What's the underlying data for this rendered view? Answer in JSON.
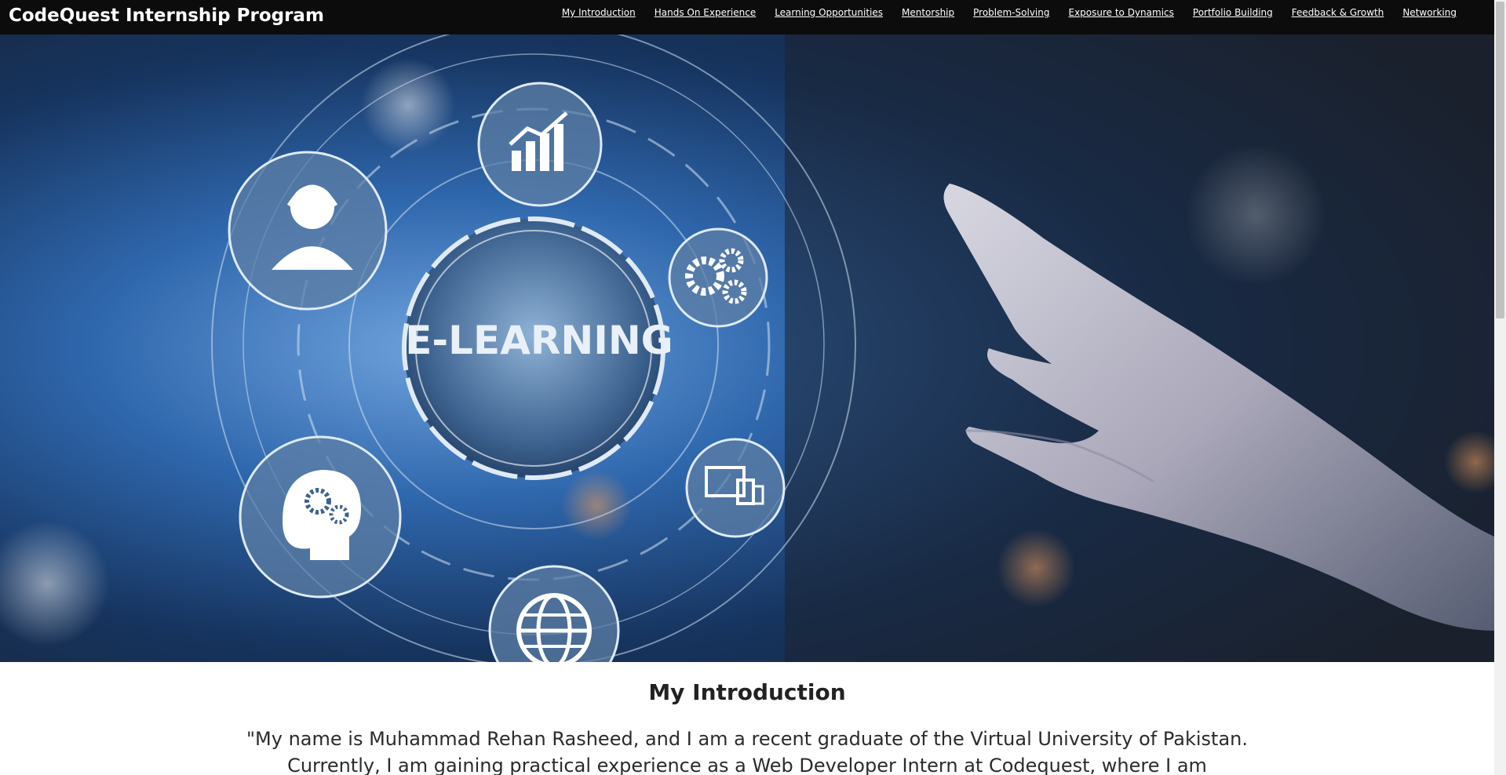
{
  "header": {
    "brand": "CodeQuest Internship Program",
    "nav": [
      "My Introduction",
      "Hands On Experience",
      "Learning Opportunities",
      "Mentorship",
      "Problem-Solving",
      "Exposure to Dynamics",
      "Portfolio Building",
      "Feedback & Growth",
      "Networking"
    ]
  },
  "hero": {
    "center_label": "E-LEARNING",
    "icons": [
      "chart-icon",
      "support-agent-icon",
      "gears-icon",
      "devices-icon",
      "brain-gears-icon",
      "globe-icon"
    ]
  },
  "intro": {
    "title": "My Introduction",
    "text": "\"My name is Muhammad Rehan Rasheed, and I am a recent graduate of the Virtual University of Pakistan. Currently, I am gaining practical experience as a Web Developer Intern at Codequest, where I am dedicated to expanding my"
  },
  "colors": {
    "topbar": "#0c0c0c",
    "hero_blue": "#1f4d8e",
    "text": "#222222"
  }
}
